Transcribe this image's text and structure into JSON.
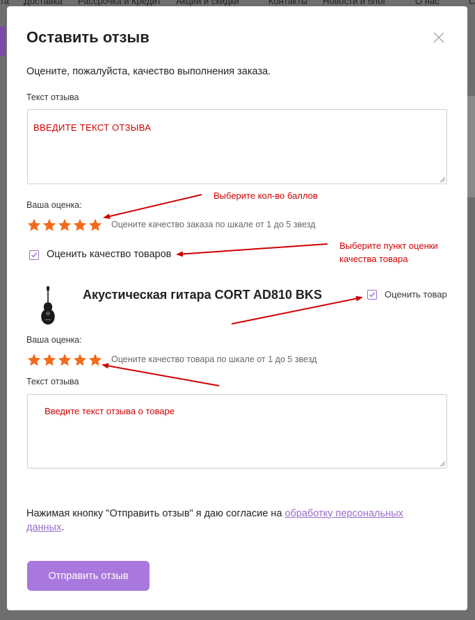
{
  "background_nav": [
    "та",
    "Доставка",
    "Рассрочка и Кредит",
    "Акции и скидки",
    "Контакты",
    "Новости и блог",
    "О нас",
    "С"
  ],
  "modal": {
    "title": "Оставить отзыв",
    "subtitle": "Оцените, пожалуйста, качество выполнения заказа.",
    "order": {
      "text_label": "Текст отзыва",
      "text_placeholder": "ВВЕДИТЕ ТЕКСТ ОТЗЫВА",
      "rating_label": "Ваша оценка:",
      "rating_value": 5,
      "rating_max": 5,
      "rating_hint": "Оцените качество заказа по шкале от 1 до 5 звезд"
    },
    "rate_products_checkbox": {
      "label": "Оценить качество товаров",
      "checked": true
    },
    "product": {
      "name": "Акустическая гитара CORT AD810 BKS",
      "rate_checkbox_label": "Оценить товар",
      "rate_checked": true,
      "rating_label": "Ваша оценка:",
      "rating_value": 5,
      "rating_max": 5,
      "rating_hint": "Оцените качество товара по шкале от 1 до 5 звезд",
      "text_label": "Текст отзыва",
      "text_placeholder": "Введите текст отзыва о товаре"
    },
    "consent_prefix": "Нажимая кнопку \"Отправить отзыв\" я даю согласие на ",
    "consent_link": "обработку персональных данных",
    "consent_suffix": ".",
    "submit_label": "Отправить отзыв"
  },
  "annotations": {
    "choose_points": "Выберите кол-во баллов",
    "choose_quality_line1": "Выберите пункт оценки",
    "choose_quality_line2": "качества товара"
  },
  "colors": {
    "star": "#f26b1d",
    "accent": "#a978de",
    "annotation": "#d10000"
  }
}
